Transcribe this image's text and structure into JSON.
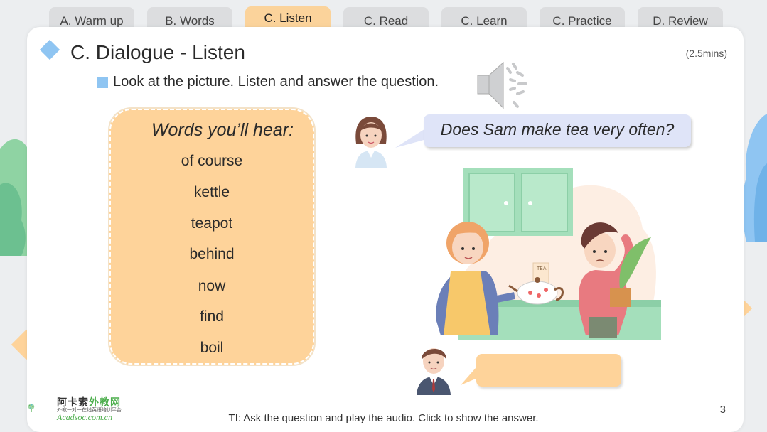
{
  "tabs": [
    {
      "label": "A. Warm up",
      "active": false
    },
    {
      "label": "B. Words",
      "active": false
    },
    {
      "label": "C. Listen",
      "active": true
    },
    {
      "label": "C. Read",
      "active": false
    },
    {
      "label": "C. Learn",
      "active": false
    },
    {
      "label": "C. Practice",
      "active": false
    },
    {
      "label": "D. Review",
      "active": false
    }
  ],
  "slide": {
    "title": "C. Dialogue - Listen",
    "duration": "(2.5mins)",
    "instruction": "Look at the picture. Listen and answer the question.",
    "speaker_icon": "speaker-icon"
  },
  "words_card": {
    "heading": "Words you’ll hear:",
    "words": [
      "of course",
      "kettle",
      "teapot",
      "behind",
      "now",
      "find",
      "boil"
    ]
  },
  "dialogue": {
    "question": "Does Sam make tea very often?",
    "answer_blank": "",
    "illustration_label": "TEA"
  },
  "footer": {
    "note": "TI: Ask the question and play the audio. Click to show the answer.",
    "page_number": "3",
    "logo_cn": "阿卡索",
    "logo_cn_green": "外教网",
    "logo_sub": "外教一对一在线英语培训平台",
    "logo_en": "Acadsoc.com.cn"
  },
  "colors": {
    "accent_orange": "#fed39a",
    "accent_blue": "#8fc5f2",
    "bubble_blue": "#dfe4f8",
    "brand_green": "#4cae4c"
  }
}
